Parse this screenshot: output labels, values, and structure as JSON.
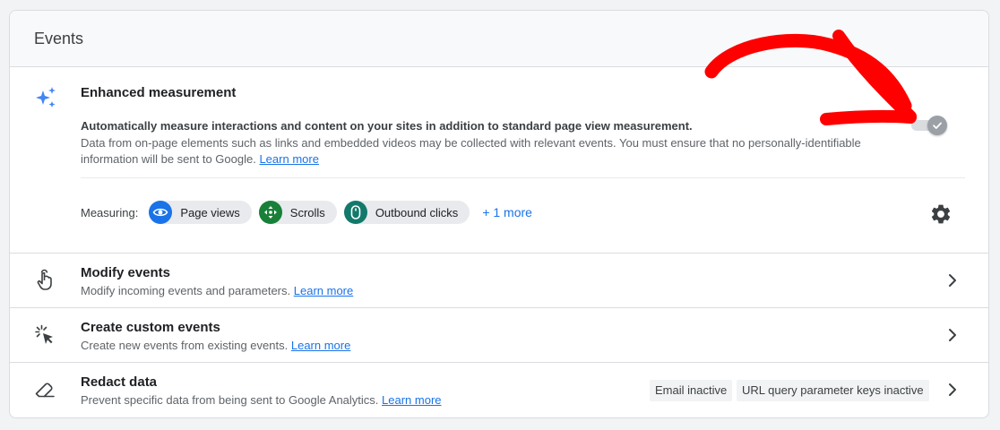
{
  "card": {
    "title": "Events"
  },
  "enhanced": {
    "title": "Enhanced measurement",
    "description_bold": "Automatically measure interactions and content on your sites in addition to standard page view measurement.",
    "description": "Data from on-page elements such as links and embedded videos may be collected with relevant events. You must ensure that no personally-identifiable information will be sent to Google.",
    "learn_more": "Learn more",
    "toggle_on": true,
    "measuring_label": "Measuring:",
    "chips": [
      {
        "label": "Page views",
        "icon": "eye-icon",
        "color": "#1a73e8"
      },
      {
        "label": "Scrolls",
        "icon": "scroll-arrows-icon",
        "color": "#188038"
      },
      {
        "label": "Outbound clicks",
        "icon": "mouse-icon",
        "color": "#12796b"
      }
    ],
    "more": "+ 1 more"
  },
  "rows": [
    {
      "title": "Modify events",
      "subtitle": "Modify incoming events and parameters.",
      "learn_more": "Learn more",
      "icon": "touch-hand-icon"
    },
    {
      "title": "Create custom events",
      "subtitle": "Create new events from existing events.",
      "learn_more": "Learn more",
      "icon": "cursor-click-icon"
    },
    {
      "title": "Redact data",
      "subtitle": "Prevent specific data from being sent to Google Analytics.",
      "learn_more": "Learn more",
      "icon": "eraser-icon",
      "badges": [
        "Email inactive",
        "URL query parameter keys inactive"
      ]
    }
  ],
  "colors": {
    "accent": "#1a73e8",
    "annotation_arrow": "#ff0000",
    "sparkle": "#4285f4"
  }
}
